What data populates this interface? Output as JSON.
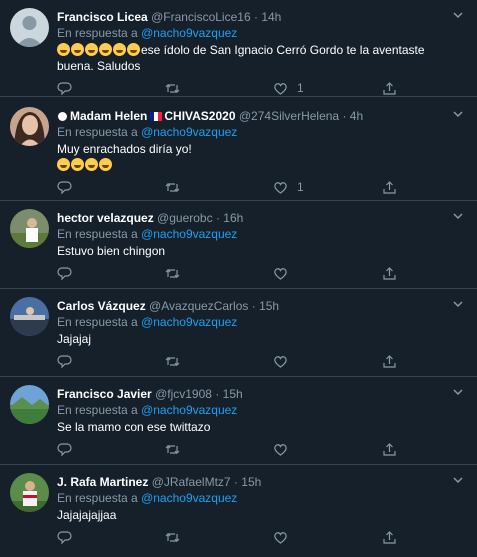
{
  "tweets": [
    {
      "name": "Francisco Licea",
      "handle": "@FranciscoLice16",
      "time": "14h",
      "reply_prefix": "",
      "mention": "@nacho9vazquez",
      "reply_label": "",
      "text_line1": "ese ídolo de San Ignacio Cerró Gordo te la aventaste",
      "text_line2": "buena. Saludos",
      "reply_count": "",
      "retweet_count": "",
      "like_count": "1"
    },
    {
      "name": "Madam Helen",
      "name_suffix": "CHIVAS2020",
      "handle": "@274SilverHelena",
      "time": "4h",
      "reply_label": "En respuesta a",
      "mention": "@nacho9vazquez",
      "text_line1": "Muy enrachados diría yo!",
      "like_count": "1"
    },
    {
      "name": "hector velazquez",
      "handle": "@guerobc",
      "time": "16h",
      "reply_label": "En respuesta a",
      "mention": "@nacho9vazquez",
      "text_line1": "Estuvo bien chingon"
    },
    {
      "name": "Carlos Vázquez",
      "handle": "@AvazquezCarlos",
      "time": "15h",
      "reply_label": "En respuesta a",
      "mention": "@nacho9vazquez",
      "text_line1": "Jajajaj"
    },
    {
      "name": "Francisco Javier",
      "handle": "@fjcv1908",
      "time": "15h",
      "reply_label": "En respuesta a",
      "mention": "@nacho9vazquez",
      "text_line1": "Se la mamo con ese twittazo"
    },
    {
      "name": "J. Rafa Martinez",
      "handle": "@JRafaelMtz7",
      "time": "15h",
      "reply_label": "En respuesta a",
      "mention": "@nacho9vazquez",
      "text_line1": "Jajajajajjaa"
    }
  ],
  "first_reply_label": "En respuesta a",
  "dot": "·",
  "colors": {
    "background": "#15202b",
    "divider": "#38444d",
    "secondary_text": "#8899a6",
    "link": "#1da1f2"
  },
  "icons": [
    "reply-icon",
    "retweet-icon",
    "like-icon",
    "share-icon",
    "caret-down-icon"
  ]
}
